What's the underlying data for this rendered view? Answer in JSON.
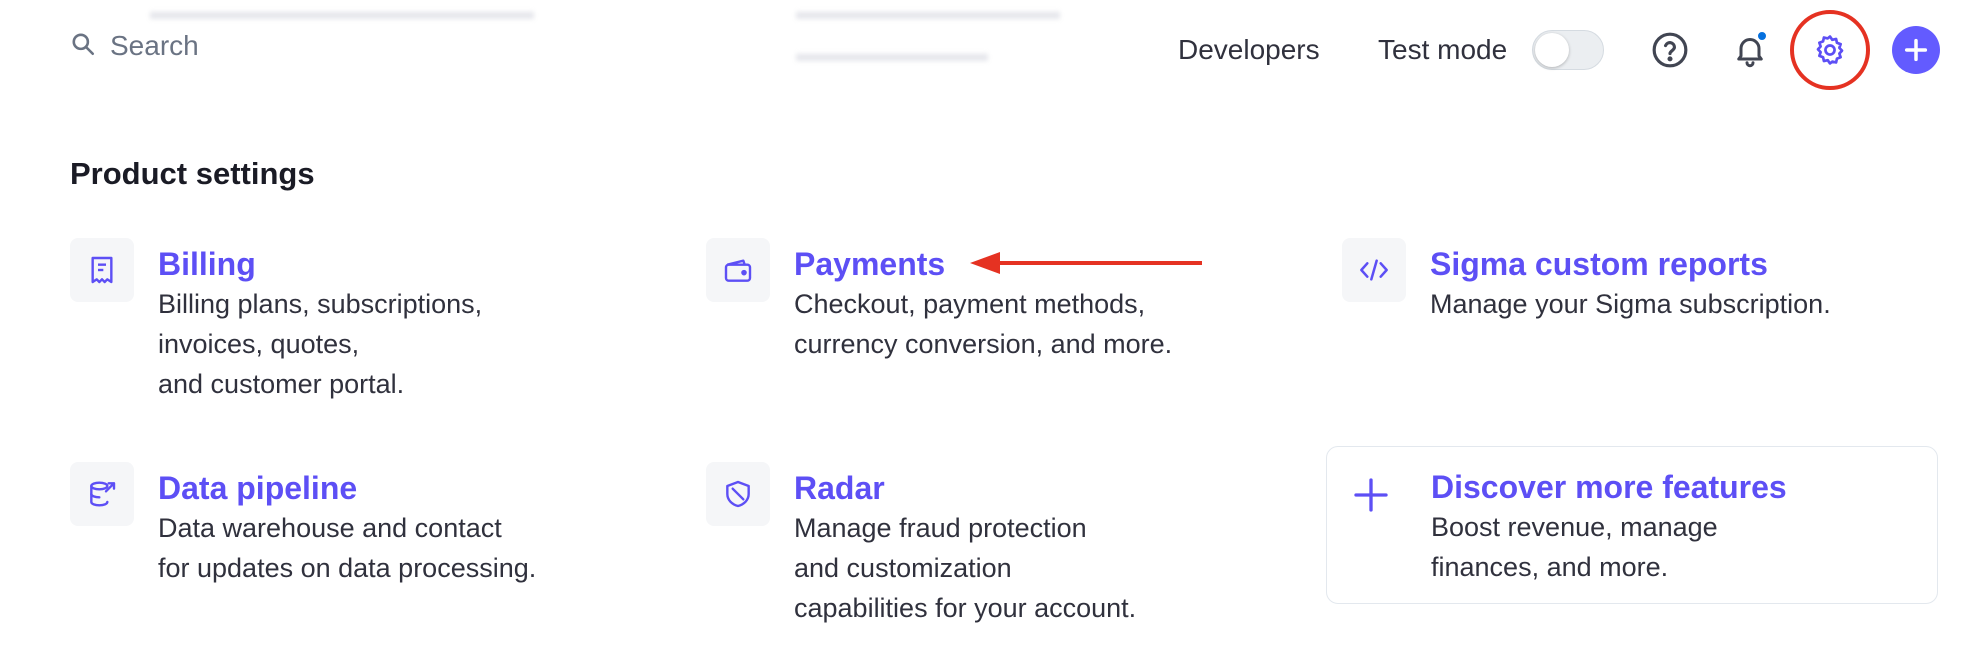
{
  "search": {
    "placeholder": "Search"
  },
  "header": {
    "developers_label": "Developers",
    "test_mode_label": "Test mode",
    "test_mode_on": false,
    "icons": [
      "search-icon",
      "help-icon",
      "bell-icon",
      "gear-icon",
      "plus-icon"
    ],
    "accent_color": "#635bff",
    "highlight_color": "#e53222"
  },
  "product_settings": {
    "title": "Product settings",
    "items": [
      {
        "title": "Billing",
        "description": "Billing plans, subscriptions,\ninvoices, quotes,\nand customer portal.",
        "icon": "receipt-icon"
      },
      {
        "title": "Payments",
        "description": "Checkout, payment methods,\ncurrency conversion, and more.",
        "icon": "wallet-icon"
      },
      {
        "title": "Sigma custom reports",
        "description": "Manage your Sigma subscription.",
        "icon": "code-icon"
      },
      {
        "title": "Data pipeline",
        "description": "Data warehouse and contact\nfor updates on data processing.",
        "icon": "database-export-icon"
      },
      {
        "title": "Radar",
        "description": "Manage fraud protection\nand customization\ncapabilities for your account.",
        "icon": "shield-icon"
      }
    ],
    "discover": {
      "title": "Discover more features",
      "description": "Boost revenue, manage\nfinances, and more.",
      "icon": "plus-icon"
    }
  }
}
